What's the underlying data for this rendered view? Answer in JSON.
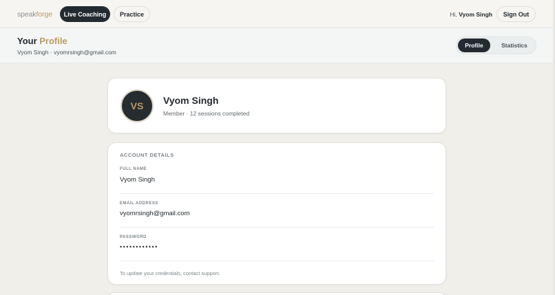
{
  "brand": {
    "part1": "speak",
    "part2": "forge"
  },
  "nav": {
    "live_coaching": "Live Coaching",
    "practice": "Practice",
    "greeting_prefix": "Hi, ",
    "greeting_name": "Vyom Singh",
    "sign_out": "Sign Out"
  },
  "header": {
    "title_part1": "Your ",
    "title_part2": "Profile",
    "subtitle": "Vyom Singh · vyomrsingh@gmail.com",
    "tabs": {
      "profile": "Profile",
      "statistics": "Statistics"
    }
  },
  "profile_card": {
    "initials": "VS",
    "name": "Vyom Singh",
    "meta": "Member · 12 sessions completed"
  },
  "account": {
    "section_title": "ACCOUNT DETAILS",
    "full_name_label": "FULL NAME",
    "full_name": "Vyom Singh",
    "email_label": "EMAIL ADDRESS",
    "email": "vyomrsingh@gmail.com",
    "password_label": "PASSWORD",
    "password": "••••••••••••",
    "note": "To update your credentials, contact support."
  },
  "colors": {
    "accent_gold": "#b89a62",
    "dark": "#232b30",
    "page_bg": "#f0efea"
  }
}
